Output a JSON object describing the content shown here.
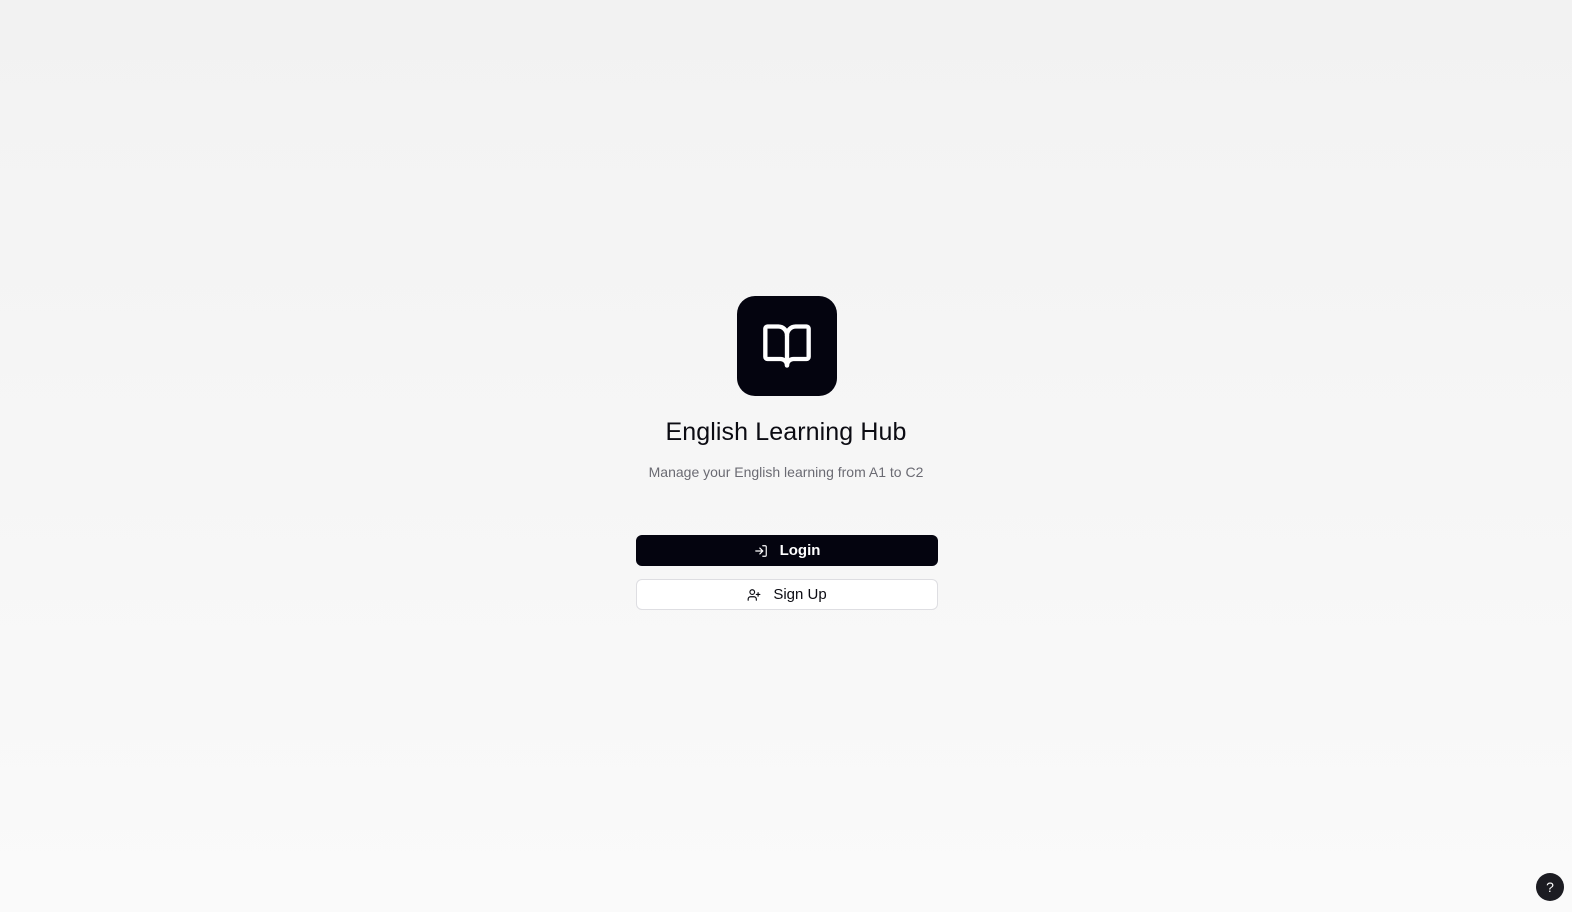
{
  "app": {
    "title": "English Learning Hub",
    "subtitle": "Manage your English learning from A1 to C2",
    "logo_icon": "book-open-icon"
  },
  "actions": {
    "login_label": "Login",
    "login_icon": "log-in-icon",
    "signup_label": "Sign Up",
    "signup_icon": "user-plus-icon"
  },
  "help": {
    "label": "?"
  },
  "colors": {
    "primary": "#04040f",
    "background": "#f4f4f4",
    "muted_text": "#6b6b73",
    "border": "#dedee2"
  }
}
